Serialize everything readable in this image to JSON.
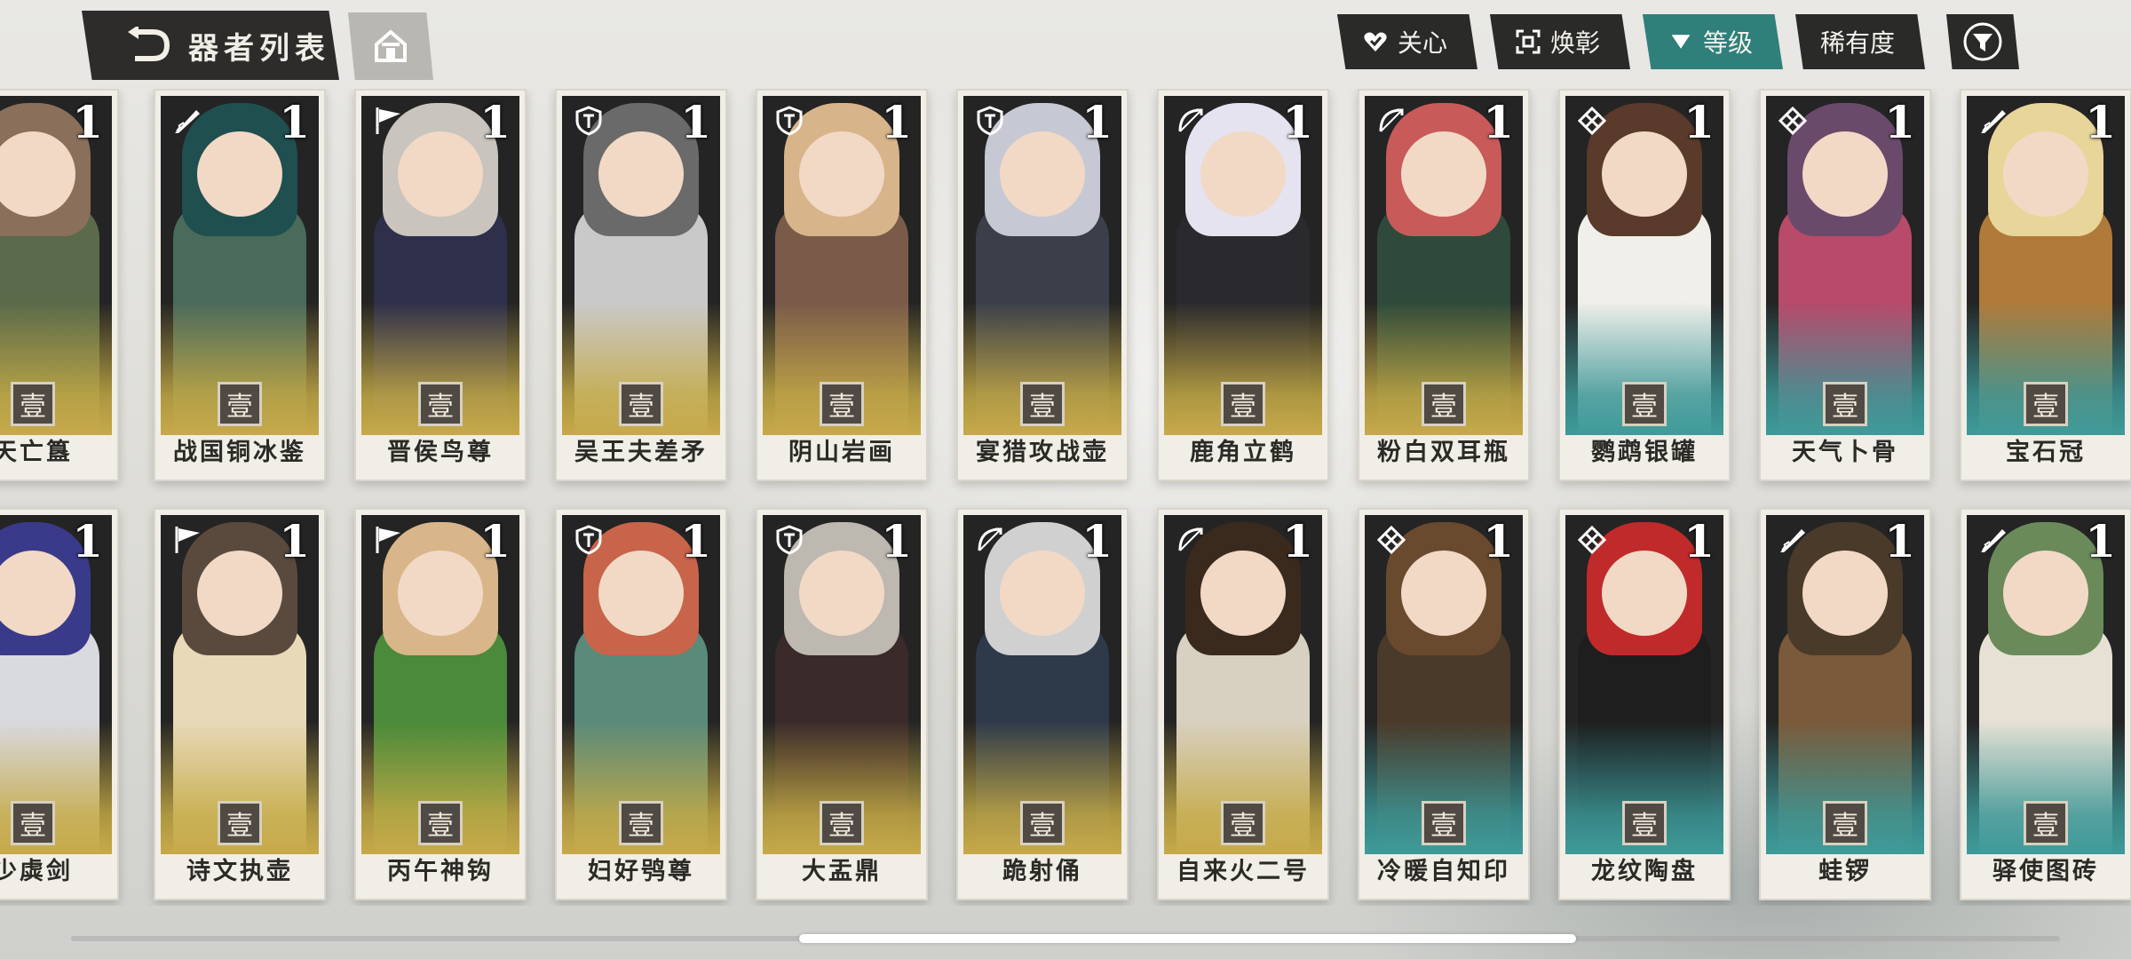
{
  "header": {
    "title": "器者列表",
    "back_icon": "back-arrow-icon",
    "home_icon": "home-icon"
  },
  "filters": [
    {
      "label": "关心",
      "icon": "heart-check-icon",
      "active": false
    },
    {
      "label": "焕彰",
      "icon": "focus-frame-icon",
      "active": false
    },
    {
      "label": "等级",
      "icon": "triangle-down-icon",
      "active": true
    },
    {
      "label": "稀有度",
      "icon": "",
      "active": false
    }
  ],
  "filter_icon": "funnel-icon",
  "colors": {
    "accent": "#2f7f7a",
    "dark": "#2a2a28",
    "gold": "#c7a94a",
    "teal": "#3e9b99"
  },
  "rank_glyph": "壹",
  "rows": [
    [
      {
        "name": "天亡簋",
        "level": "1",
        "class": "shield",
        "tone": "gold"
      },
      {
        "name": "战国铜冰鉴",
        "level": "1",
        "class": "quill",
        "tone": "gold"
      },
      {
        "name": "晋侯鸟尊",
        "level": "1",
        "class": "flag",
        "tone": "gold"
      },
      {
        "name": "吴王夫差矛",
        "level": "1",
        "class": "shield",
        "tone": "gold"
      },
      {
        "name": "阴山岩画",
        "level": "1",
        "class": "shield",
        "tone": "gold"
      },
      {
        "name": "宴猎攻战壶",
        "level": "1",
        "class": "shield",
        "tone": "gold"
      },
      {
        "name": "鹿角立鹤",
        "level": "1",
        "class": "bow",
        "tone": "gold"
      },
      {
        "name": "粉白双耳瓶",
        "level": "1",
        "class": "bow",
        "tone": "gold"
      },
      {
        "name": "鹦鹉银罐",
        "level": "1",
        "class": "knot",
        "tone": "teal"
      },
      {
        "name": "天气卜骨",
        "level": "1",
        "class": "knot",
        "tone": "teal"
      },
      {
        "name": "宝石冠",
        "level": "1",
        "class": "quill",
        "tone": "teal"
      }
    ],
    [
      {
        "name": "少虡剑",
        "level": "1",
        "class": "shield",
        "tone": "gold"
      },
      {
        "name": "诗文执壶",
        "level": "1",
        "class": "flag",
        "tone": "gold"
      },
      {
        "name": "丙午神钩",
        "level": "1",
        "class": "flag",
        "tone": "gold"
      },
      {
        "name": "妇好鸮尊",
        "level": "1",
        "class": "shield",
        "tone": "gold"
      },
      {
        "name": "大盂鼎",
        "level": "1",
        "class": "shield",
        "tone": "gold"
      },
      {
        "name": "跪射俑",
        "level": "1",
        "class": "bow",
        "tone": "gold"
      },
      {
        "name": "自来火二号",
        "level": "1",
        "class": "bow",
        "tone": "gold"
      },
      {
        "name": "冷暖自知印",
        "level": "1",
        "class": "knot",
        "tone": "teal"
      },
      {
        "name": "龙纹陶盘",
        "level": "1",
        "class": "knot",
        "tone": "teal"
      },
      {
        "name": "蛙锣",
        "level": "1",
        "class": "quill",
        "tone": "teal"
      },
      {
        "name": "驿使图砖",
        "level": "1",
        "class": "quill",
        "tone": "teal"
      }
    ]
  ],
  "scroll": {
    "position": 0.53
  }
}
